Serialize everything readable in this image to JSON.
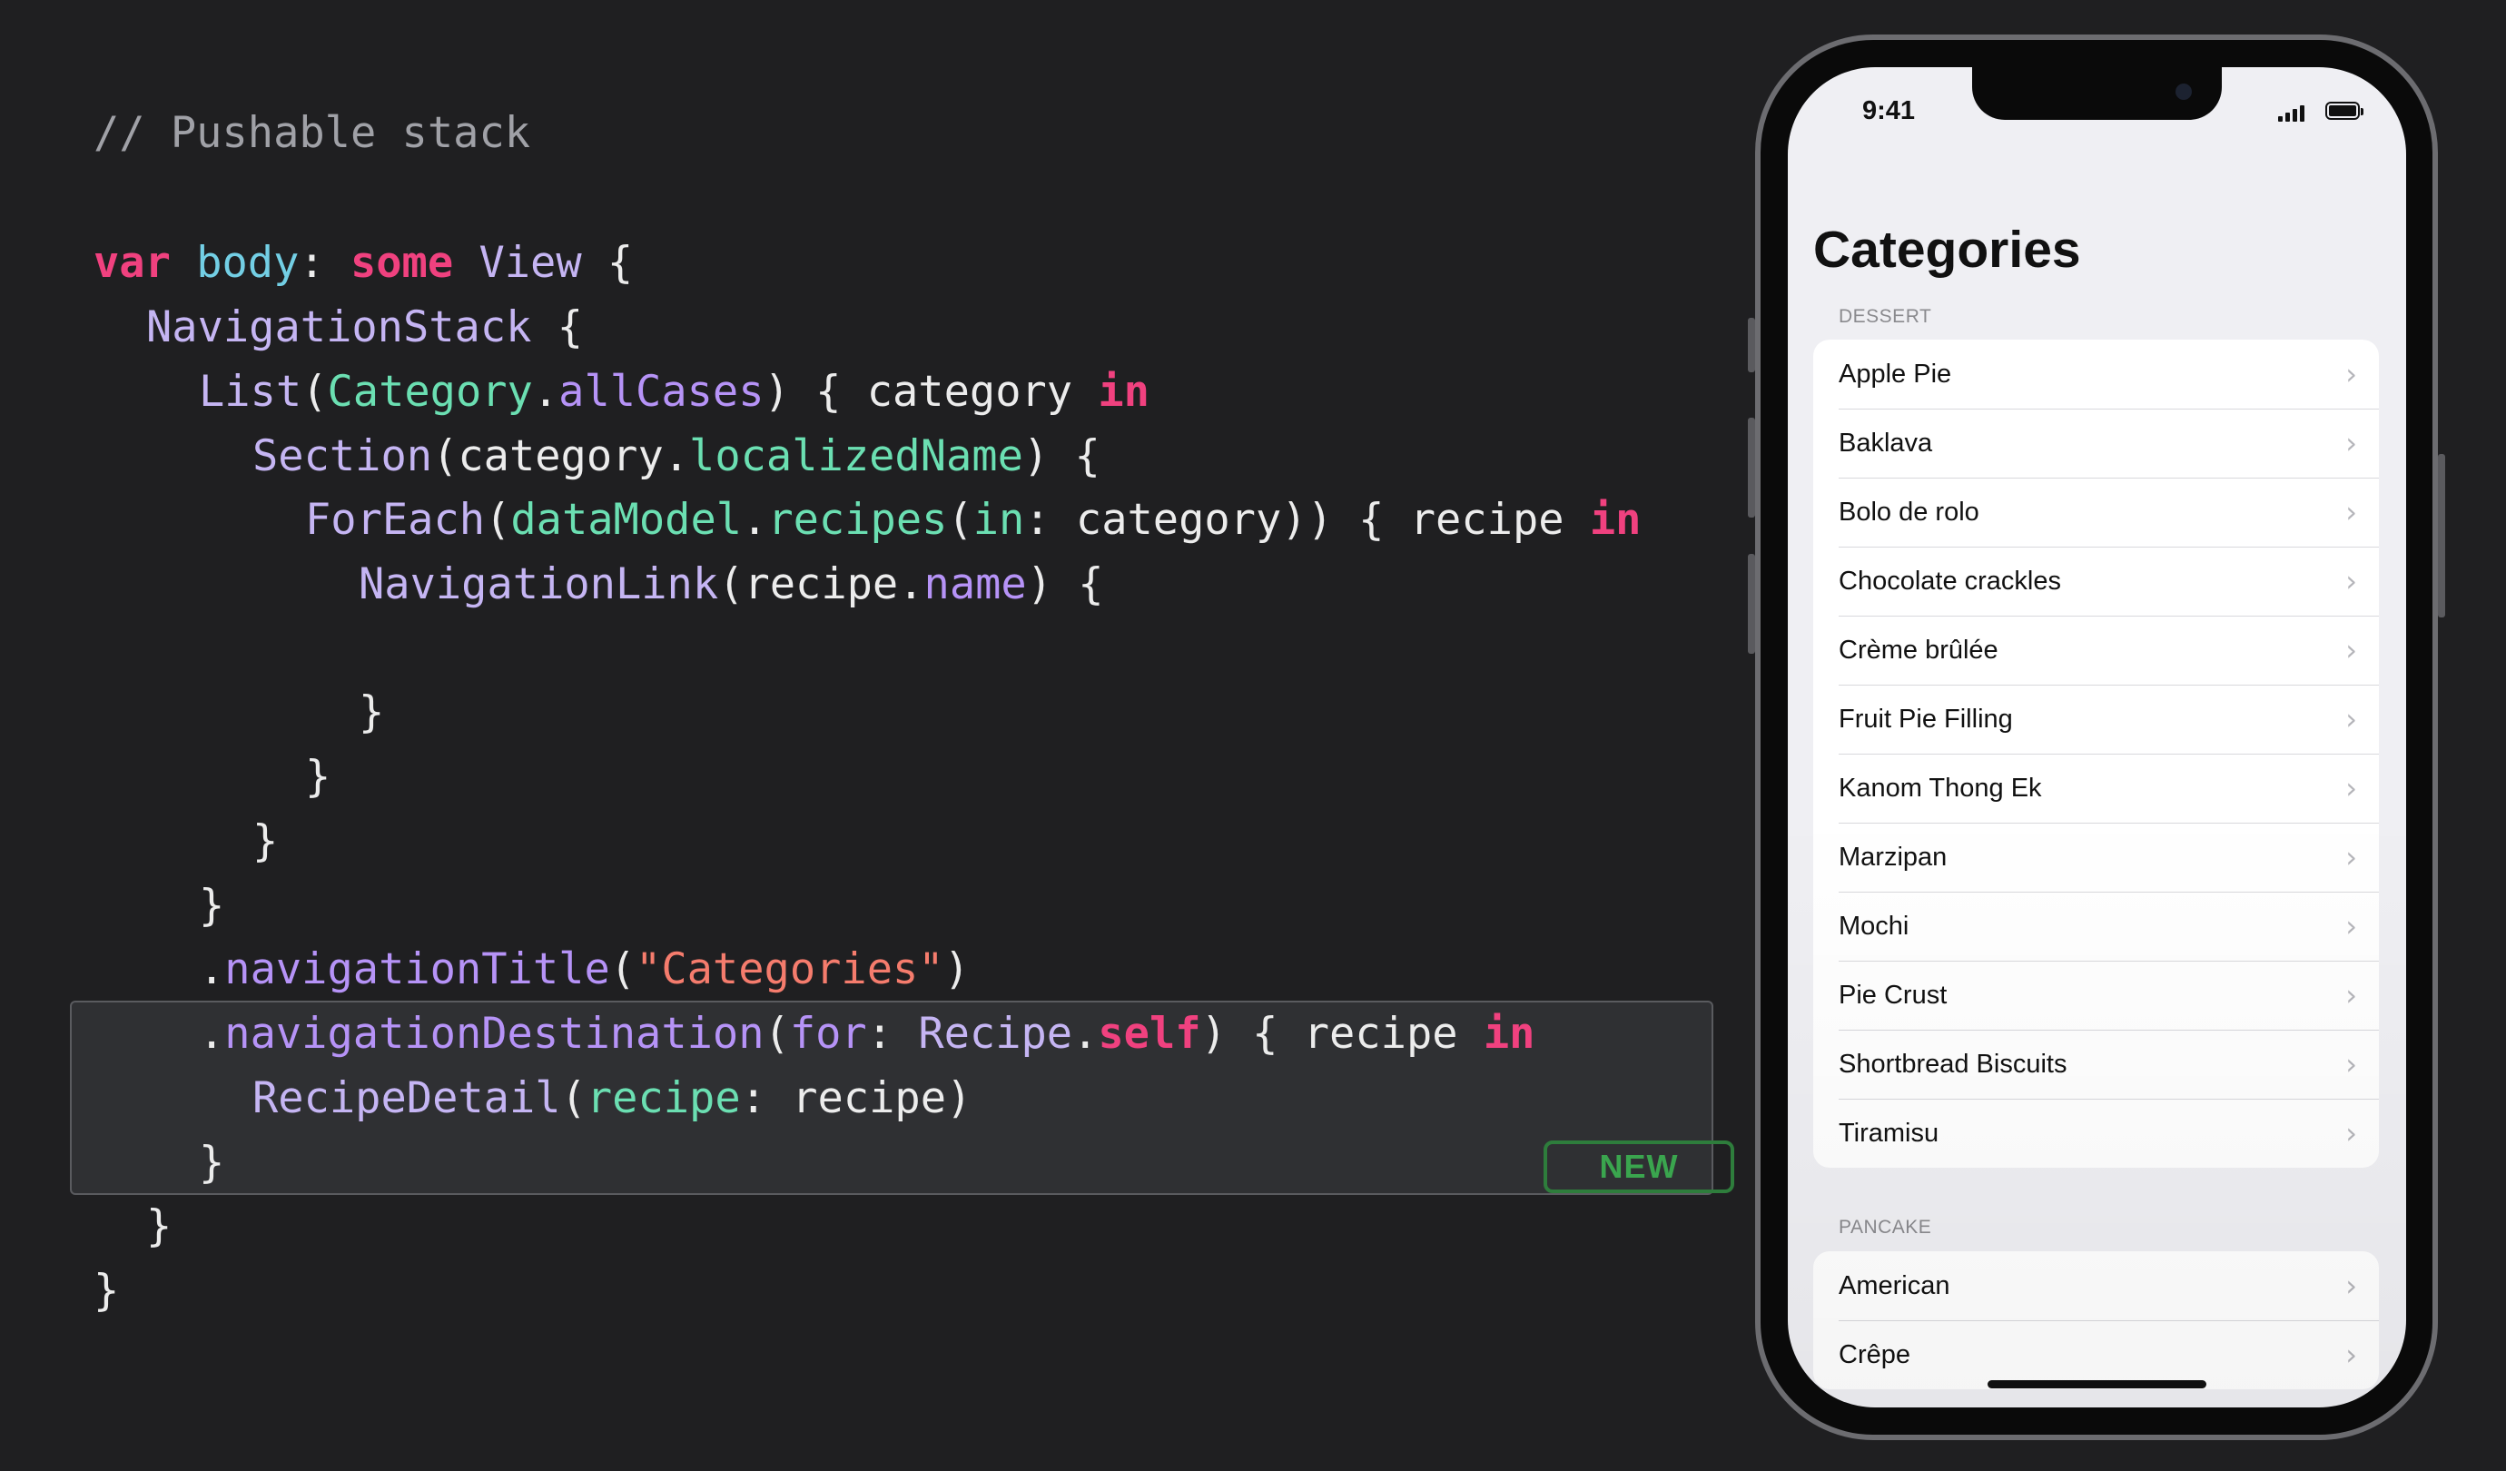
{
  "code": {
    "comment": "// Pushable stack",
    "new_badge": "NEW",
    "lines": {
      "l1": {
        "a": "var",
        "b": " ",
        "c": "body",
        "d": ": ",
        "e": "some",
        "f": " ",
        "g": "View",
        "h": " {"
      },
      "l2": {
        "a": "NavigationStack",
        "b": " {"
      },
      "l3": {
        "a": "List",
        "b": "(",
        "c": "Category",
        "d": ".",
        "e": "allCases",
        "f": ") { category ",
        "g": "in"
      },
      "l4": {
        "a": "Section",
        "b": "(category.",
        "c": "localizedName",
        "d": ") {"
      },
      "l5": {
        "a": "ForEach",
        "b": "(",
        "c": "dataModel",
        "d": ".",
        "e": "recipes",
        "f": "(",
        "g": "in",
        "h": ": category)) { recipe ",
        "i": "in"
      },
      "l6": {
        "a": "NavigationLink",
        "b": "(recipe.",
        "c": "name",
        "d": ") {"
      },
      "l8": "}",
      "l9": "}",
      "l10": "}",
      "l11": "}",
      "l12": {
        "a": ".",
        "b": "navigationTitle",
        "c": "(",
        "d": "\"Categories\"",
        "e": ")"
      },
      "l13": {
        "a": ".",
        "b": "navigationDestination",
        "c": "(",
        "d": "for",
        "e": ": ",
        "f": "Recipe",
        "g": ".",
        "h": "self",
        "i": ") { recipe ",
        "j": "in"
      },
      "l14": {
        "a": "RecipeDetail",
        "b": "(",
        "c": "recipe",
        "d": ": recipe)"
      },
      "l15": "}",
      "l16": "}",
      "l17": "}"
    }
  },
  "phone": {
    "status": {
      "time": "9:41"
    },
    "nav_title": "Categories",
    "sections": [
      {
        "header": "DESSERT",
        "items": [
          "Apple Pie",
          "Baklava",
          "Bolo de rolo",
          "Chocolate crackles",
          "Crème brûlée",
          "Fruit Pie Filling",
          "Kanom Thong Ek",
          "Marzipan",
          "Mochi",
          "Pie Crust",
          "Shortbread Biscuits",
          "Tiramisu"
        ]
      },
      {
        "header": "PANCAKE",
        "items": [
          "American",
          "Crêpe"
        ]
      }
    ],
    "chevron": "›"
  },
  "colors": {
    "background": "#1f1f21",
    "keyword": "#f0417f",
    "type": "#c5b5f3",
    "property": "#73cfe5",
    "method": "#6bdfb2",
    "string": "#f57c6d",
    "new_badge": "#3aa54e"
  }
}
